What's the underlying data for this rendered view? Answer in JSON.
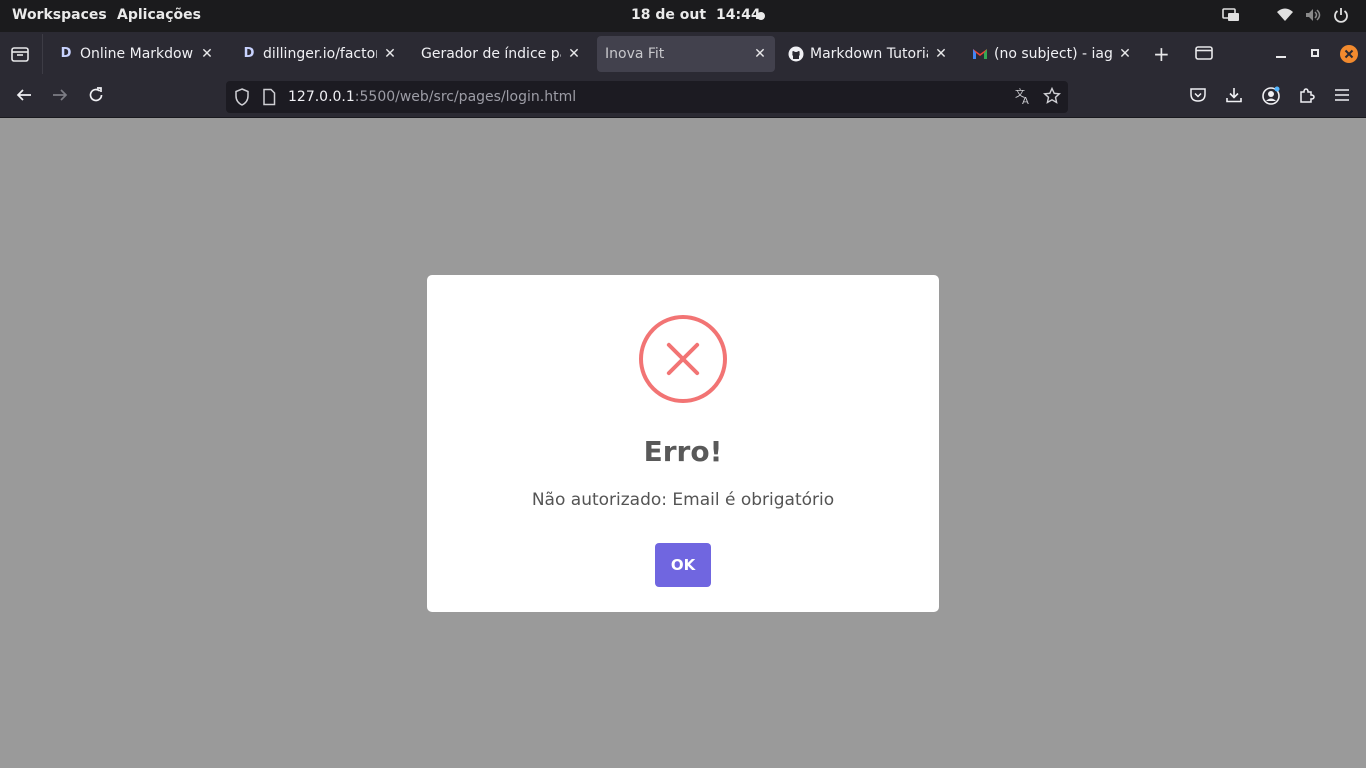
{
  "os_bar": {
    "workspaces": "Workspaces",
    "applications": "Aplicações",
    "date": "18 de out",
    "time": "14:44"
  },
  "tabs": [
    {
      "favicon": "D",
      "title": "Online Markdown Ed",
      "active": false
    },
    {
      "favicon": "D",
      "title": "dillinger.io/factory/f",
      "active": false
    },
    {
      "favicon": "",
      "title": "Gerador de índice para M",
      "active": false
    },
    {
      "favicon": "",
      "title": "Inova Fit",
      "active": true
    },
    {
      "favicon": "github-icon",
      "title": "Markdown Tutorial",
      "active": false
    },
    {
      "favicon": "gmail-icon",
      "title": "(no subject) - iago.ac",
      "active": false
    }
  ],
  "address_bar": {
    "host": "127.0.0.1",
    "path": ":5500/web/src/pages/login.html"
  },
  "dialog": {
    "title": "Erro!",
    "message": "Não autorizado: Email é obrigatório",
    "ok_label": "OK"
  },
  "colors": {
    "error_red": "#f27474",
    "confirm_button": "#7066e0",
    "overlay": "#9a9a9a",
    "browser_chrome": "#2b2a33",
    "os_bar": "#1b1b1d"
  }
}
